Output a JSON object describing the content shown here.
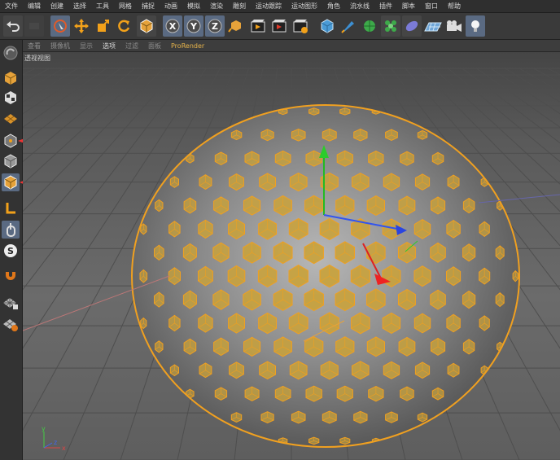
{
  "menu": [
    "文件",
    "编辑",
    "创建",
    "选择",
    "工具",
    "网格",
    "捕捉",
    "动画",
    "模拟",
    "渲染",
    "雕刻",
    "运动跟踪",
    "运动图形",
    "角色",
    "流水线",
    "插件",
    "脚本",
    "窗口",
    "帮助"
  ],
  "toolbar": {
    "icons": [
      "undo-icon",
      "redo-icon",
      "live-selection-icon",
      "move-icon",
      "scale-icon",
      "rotate-icon",
      "object-mode-icon",
      "x-axis-icon",
      "y-axis-icon",
      "z-axis-icon",
      "coordinate-system-icon",
      "render-view-icon",
      "render-picture-viewer-icon",
      "render-settings-icon",
      "cube-icon",
      "pen-icon",
      "subdivision-icon",
      "cloner-icon",
      "deformer-icon",
      "floor-icon",
      "camera-icon",
      "light-icon"
    ],
    "axis_labels": {
      "x": "X",
      "y": "Y",
      "z": "Z"
    }
  },
  "viewport_menu": [
    {
      "label": "查看",
      "selected": false
    },
    {
      "label": "摄像机",
      "selected": false
    },
    {
      "label": "显示",
      "selected": false
    },
    {
      "label": "选项",
      "selected": true
    },
    {
      "label": "过滤",
      "selected": false
    },
    {
      "label": "面板",
      "selected": false
    },
    {
      "label": "ProRender",
      "selected": false,
      "accent": true
    }
  ],
  "viewport": {
    "label": "透视视图",
    "object": "geodesic-sphere",
    "colors": {
      "sphere_fill": "#c9a23a",
      "edge": "#f0a020",
      "background": "#5c5c5c",
      "grid": "#4a4a4a"
    }
  },
  "left_tools": [
    "make-editable-icon",
    "texture-mode-icon",
    "workplane-icon",
    "point-mode-icon",
    "edge-mode-icon",
    "polygon-mode-icon",
    "axis-mode-icon",
    "tweak-icon",
    "solo-icon",
    "magnet-icon",
    "enable-snap-icon",
    "lock-workplane-icon"
  ],
  "axis_gizmo": {
    "x": "x",
    "y": "y",
    "z": "z"
  }
}
